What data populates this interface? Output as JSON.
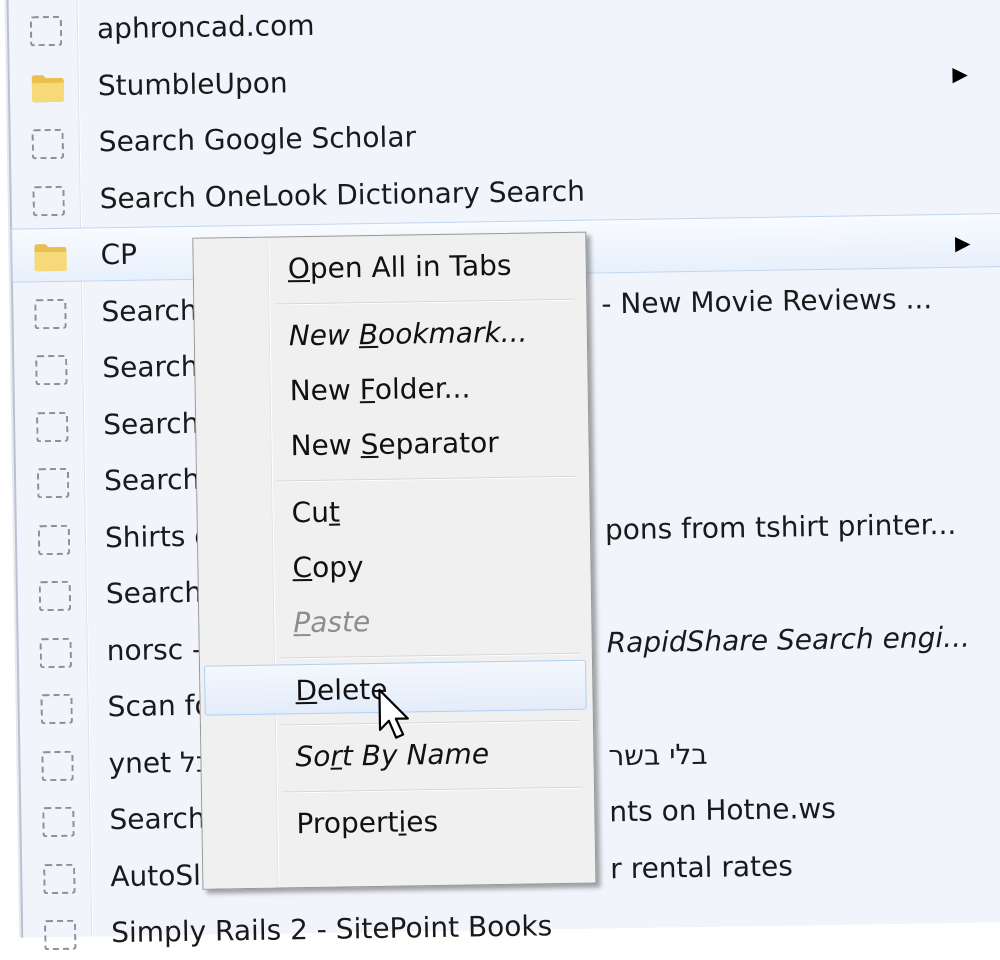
{
  "bookmarks": [
    {
      "label": "aphroncad.com",
      "icon": "blank-page-icon"
    },
    {
      "label": "StumbleUpon",
      "icon": "folder-icon",
      "submenu": true
    },
    {
      "label": "Search Google Scholar",
      "icon": "blank-page-icon"
    },
    {
      "label": "Search OneLook Dictionary Search",
      "icon": "blank-page-icon"
    },
    {
      "label": "CP",
      "icon": "folder-icon",
      "submenu": true,
      "hovered": true
    },
    {
      "label": "Search R",
      "icon": "blank-page-icon",
      "right": "- New Movie Reviews ..."
    },
    {
      "label": "Search C",
      "icon": "blank-page-icon"
    },
    {
      "label": "Search A",
      "icon": "blank-page-icon"
    },
    {
      "label": "Search c",
      "icon": "blank-page-icon"
    },
    {
      "label": "Shirts or",
      "icon": "blank-page-icon",
      "right": "pons from tshirt printer..."
    },
    {
      "label": "Search a",
      "icon": "blank-page-icon"
    },
    {
      "label": "norsc - ",
      "icon": "blank-page-icon",
      "right": "RapidShare Search engi...",
      "right_italic": true
    },
    {
      "label": "Scan for",
      "icon": "blank-page-icon"
    },
    {
      "label": "ynet הכל",
      "icon": "blank-page-icon",
      "right": "בלי בשר"
    },
    {
      "label": "Search T",
      "icon": "blank-page-icon",
      "right": "nts on Hotne.ws"
    },
    {
      "label": "AutoSla",
      "icon": "blank-page-icon",
      "right": "r rental rates"
    },
    {
      "label": "Simply Rails 2 - SitePoint Books",
      "icon": "blank-page-icon"
    }
  ],
  "context_menu": {
    "items": [
      {
        "label": "Open All in Tabs",
        "accel": "O",
        "name": "open-all-in-tabs-item"
      },
      {
        "separator": true
      },
      {
        "label": "New Bookmark...",
        "accel": "B",
        "italic": true,
        "name": "new-bookmark-item"
      },
      {
        "label": "New Folder...",
        "accel": "F",
        "name": "new-folder-item"
      },
      {
        "label": "New Separator",
        "accel": "S",
        "name": "new-separator-item"
      },
      {
        "separator": true
      },
      {
        "label": "Cut",
        "accel": "t",
        "name": "cut-item"
      },
      {
        "label": "Copy",
        "accel": "C",
        "name": "copy-item"
      },
      {
        "label": "Paste",
        "accel": "P",
        "disabled": true,
        "italic": true,
        "name": "paste-item"
      },
      {
        "separator": true
      },
      {
        "label": "Delete",
        "accel": "D",
        "hovered": true,
        "name": "delete-item"
      },
      {
        "separator": true
      },
      {
        "label": "Sort By Name",
        "accel": "r",
        "italic": true,
        "name": "sort-by-name-item"
      },
      {
        "separator": true
      },
      {
        "label": "Properties",
        "accel": "i",
        "name": "properties-item"
      }
    ]
  },
  "colors": {
    "menu_bg": "#f1f4fb",
    "context_bg": "#f0f0f0",
    "hover_border": "#aecff7",
    "folder_yellow": "#f3d46a",
    "disabled_text": "#8d8d8d"
  }
}
